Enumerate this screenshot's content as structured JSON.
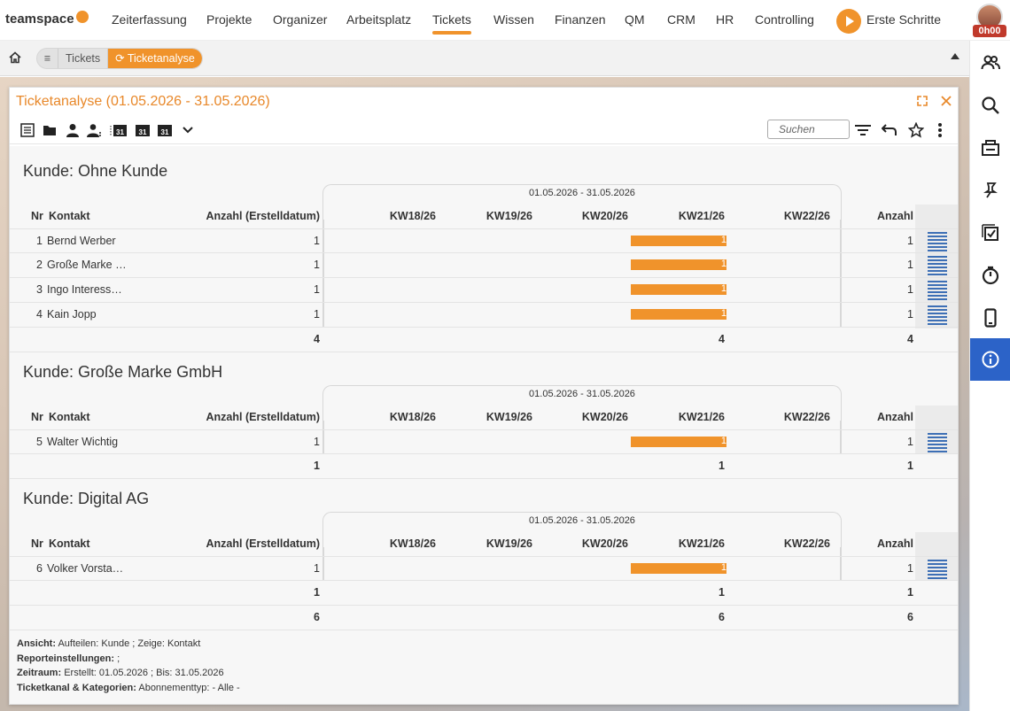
{
  "brand": {
    "logo": "teamspace",
    "accent": "#f0932b",
    "active_blue": "#2c63c8"
  },
  "nav": {
    "items": [
      "Zeiterfassung",
      "Projekte",
      "Organizer",
      "Arbeitsplatz",
      "Tickets",
      "Wissen",
      "Finanzen",
      "QM",
      "CRM",
      "HR",
      "Controlling"
    ],
    "active": "Tickets",
    "erste_schritte": "Erste Schritte",
    "time_badge": "0h00"
  },
  "breadcrumb": {
    "items": [
      "Tickets",
      "Ticketanalyse"
    ]
  },
  "panel": {
    "title": "Ticketanalyse (01.05.2026 - 31.05.2026)",
    "search_placeholder": "Suchen",
    "toolbar_icons": [
      "list-view-icon",
      "folder-icon",
      "person-icon",
      "persons-icon",
      "calendar-icon",
      "calendar-icon",
      "calendar-icon",
      "chevron-down-icon"
    ],
    "toolbar_day_labels": [
      "31",
      "31",
      "31"
    ]
  },
  "report": {
    "period": "01.05.2026 - 31.05.2026",
    "columns": {
      "nr": "Nr",
      "kontakt": "Kontakt",
      "anzahl_erstell": "Anzahl (Erstelldatum)",
      "weeks": [
        "KW18/26",
        "KW19/26",
        "KW20/26",
        "KW21/26",
        "KW22/26"
      ],
      "anzahl": "Anzahl"
    },
    "groups": [
      {
        "title": "Kunde: Ohne Kunde",
        "rows": [
          {
            "nr": "1",
            "kontakt": "Bernd Werber",
            "anzahl_erstell": "1",
            "bar": "1",
            "anzahl": "1"
          },
          {
            "nr": "2",
            "kontakt": "Große Marke …",
            "anzahl_erstell": "1",
            "bar": "1",
            "anzahl": "1"
          },
          {
            "nr": "3",
            "kontakt": "Ingo Interess…",
            "anzahl_erstell": "1",
            "bar": "1",
            "anzahl": "1"
          },
          {
            "nr": "4",
            "kontakt": "Kain Jopp",
            "anzahl_erstell": "1",
            "bar": "1",
            "anzahl": "1"
          }
        ],
        "total": {
          "anzahl_erstell": "4",
          "kw21": "4",
          "anzahl": "4"
        }
      },
      {
        "title": "Kunde: Große Marke GmbH",
        "rows": [
          {
            "nr": "5",
            "kontakt": "Walter Wichtig",
            "anzahl_erstell": "1",
            "bar": "1",
            "anzahl": "1"
          }
        ],
        "total": {
          "anzahl_erstell": "1",
          "kw21": "1",
          "anzahl": "1"
        }
      },
      {
        "title": "Kunde: Digital AG",
        "rows": [
          {
            "nr": "6",
            "kontakt": "Volker Vorsta…",
            "anzahl_erstell": "1",
            "bar": "1",
            "anzahl": "1"
          }
        ],
        "total": {
          "anzahl_erstell": "1",
          "kw21": "1",
          "anzahl": "1"
        }
      }
    ],
    "grand_total": {
      "anzahl_erstell": "6",
      "kw21": "6",
      "anzahl": "6"
    }
  },
  "footer": {
    "ansicht_label": "Ansicht:",
    "ansicht_value": "Aufteilen: Kunde ; Zeige: Kontakt",
    "report_label": "Reporteinstellungen:",
    "report_value": ";",
    "zeitraum_label": "Zeitraum:",
    "zeitraum_value": "Erstellt: 01.05.2026 ; Bis: 31.05.2026",
    "kanal_label": "Ticketkanal & Kategorien:",
    "kanal_value": "Abonnementtyp: - Alle -"
  },
  "right_sidebar": [
    "contacts-icon",
    "search-icon",
    "inbox-icon",
    "pin-icon",
    "task-check-icon",
    "timer-icon",
    "mobile-icon",
    "info-icon"
  ]
}
